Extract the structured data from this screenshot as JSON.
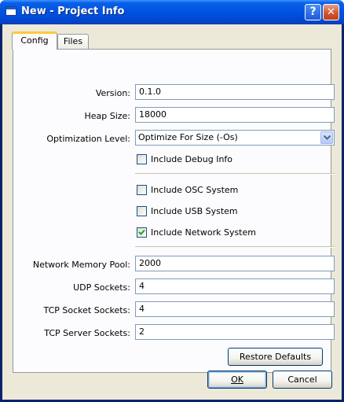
{
  "window": {
    "title": "New - Project Info",
    "help_glyph": "?",
    "close_glyph": "✕"
  },
  "tabs": [
    {
      "label": "Config",
      "active": true
    },
    {
      "label": "Files",
      "active": false
    }
  ],
  "config": {
    "version": {
      "label": "Version:",
      "value": "0.1.0"
    },
    "heap_size": {
      "label": "Heap Size:",
      "value": "18000"
    },
    "optimization": {
      "label": "Optimization Level:",
      "value": "Optimize For Size (-Os)"
    },
    "debug_info": {
      "label": "Include Debug Info",
      "checked": false
    },
    "osc_system": {
      "label": "Include OSC System",
      "checked": false
    },
    "usb_system": {
      "label": "Include USB System",
      "checked": false
    },
    "network_system": {
      "label": "Include Network System",
      "checked": true
    },
    "network_memory_pool": {
      "label": "Network Memory Pool:",
      "value": "2000"
    },
    "udp_sockets": {
      "label": "UDP Sockets:",
      "value": "4"
    },
    "tcp_sockets": {
      "label": "TCP Socket Sockets:",
      "value": "4"
    },
    "tcp_server_sockets": {
      "label": "TCP Server Sockets:",
      "value": "2"
    },
    "restore_defaults_label": "Restore Defaults"
  },
  "footer": {
    "ok_label": "OK",
    "cancel_label": "Cancel"
  },
  "colors": {
    "titlebar": "#0054e3",
    "check_mark": "#21a121",
    "panel_background": "#fcfcfe",
    "dialog_background": "#ece9d8"
  }
}
